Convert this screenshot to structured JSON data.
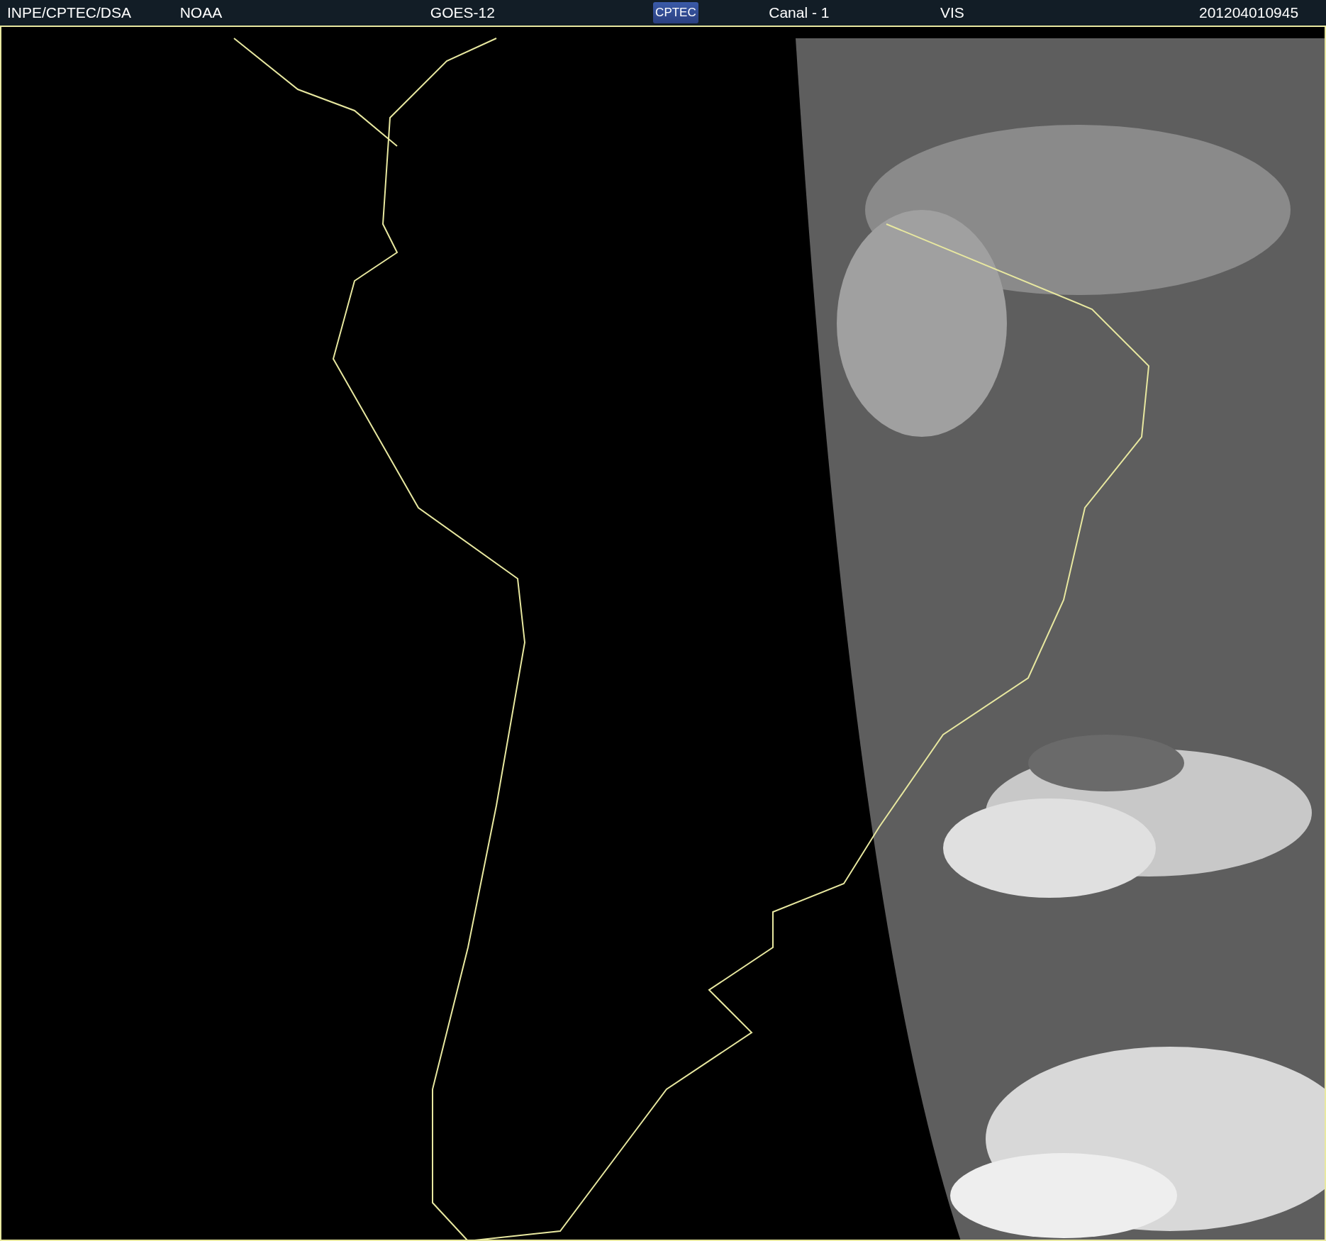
{
  "header": {
    "items": [
      {
        "kind": "text",
        "text": "INPE/CPTEC/DSA"
      },
      {
        "kind": "text",
        "text": "NOAA"
      },
      {
        "kind": "text",
        "text": "GOES-12"
      },
      {
        "kind": "logo",
        "text": "CPTEC"
      },
      {
        "kind": "text",
        "text": "Canal - 1"
      },
      {
        "kind": "text",
        "text": "VIS"
      },
      {
        "kind": "text",
        "text": "201204010945"
      }
    ]
  }
}
